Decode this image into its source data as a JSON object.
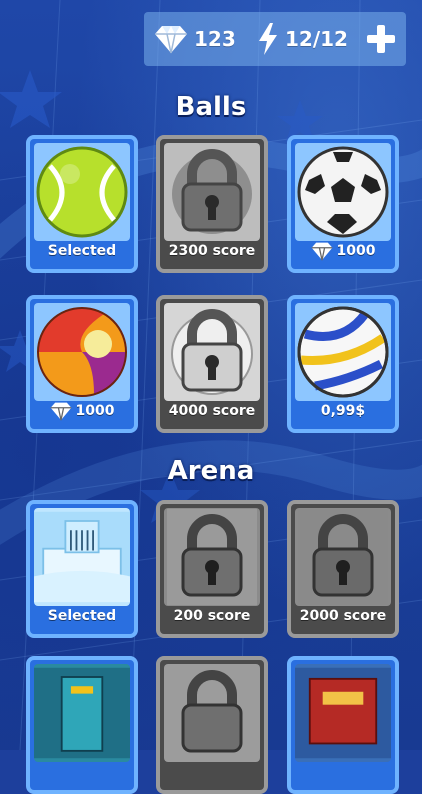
{
  "header": {
    "gems": "123",
    "energy": "12/12"
  },
  "sections": {
    "balls_title": "Balls",
    "arena_title": "Arena"
  },
  "balls": [
    {
      "label": "Selected",
      "state": "selected"
    },
    {
      "label": "2300 score",
      "state": "locked"
    },
    {
      "label": "1000",
      "state": "gem-price"
    },
    {
      "label": "1000",
      "state": "gem-price"
    },
    {
      "label": "4000 score",
      "state": "locked"
    },
    {
      "label": "0,99$",
      "state": "paid"
    }
  ],
  "arenas": [
    {
      "label": "Selected",
      "state": "selected"
    },
    {
      "label": "200 score",
      "state": "locked"
    },
    {
      "label": "2000 score",
      "state": "locked"
    }
  ],
  "colors": {
    "background": "#1d3f9c",
    "card_active": "#2a6fe0",
    "card_locked": "#4b4b4b"
  }
}
